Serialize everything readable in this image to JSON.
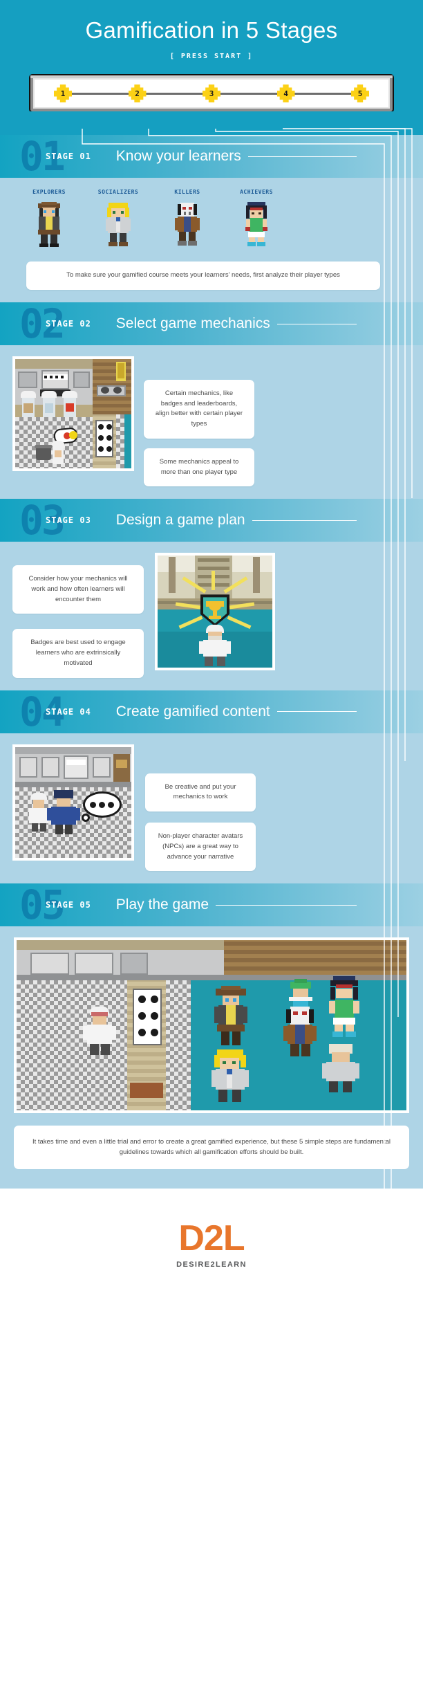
{
  "header": {
    "title": "Gamification in 5 Stages",
    "press_start": "[ PRESS START ]",
    "bg_color": "#159fc1"
  },
  "progress": {
    "nodes": [
      "1",
      "2",
      "3",
      "4",
      "5"
    ],
    "node_color": "#fcd116"
  },
  "stages": [
    {
      "number": "01",
      "tag": "STAGE 01",
      "heading": "Know your learners",
      "player_types": [
        {
          "label": "EXPLORERS"
        },
        {
          "label": "SOCIALIZERS"
        },
        {
          "label": "KILLERS"
        },
        {
          "label": "ACHIEVERS"
        }
      ],
      "callouts": [
        "To make sure your gamified course meets your learners' needs, first analyze their player types"
      ]
    },
    {
      "number": "02",
      "tag": "STAGE 02",
      "heading": "Select game mechanics",
      "callouts": [
        "Certain mechanics, like badges and leaderboards, align better with certain player types",
        "Some mechanics appeal to more than one player type"
      ]
    },
    {
      "number": "03",
      "tag": "STAGE 03",
      "heading": "Design a game plan",
      "callouts": [
        "Consider how your mechanics will work and how often learners will encounter them",
        "Badges are best used to engage learners who are extrinsically motivated"
      ]
    },
    {
      "number": "04",
      "tag": "STAGE 04",
      "heading": "Create gamified content",
      "callouts": [
        "Be creative and put your mechanics to work",
        "Non-player character avatars (NPCs) are a great way to advance your narrative"
      ]
    },
    {
      "number": "05",
      "tag": "STAGE 05",
      "heading": "Play the game",
      "callouts": []
    }
  ],
  "final_note": "It takes time and even a little trial and error to create a great gamified experience, but these 5 simple steps are fundamental guidelines towards which all gamification efforts should be built.",
  "footer": {
    "logo": "D2L",
    "tagline": "DESIRE2LEARN",
    "logo_color": "#e8762c"
  }
}
